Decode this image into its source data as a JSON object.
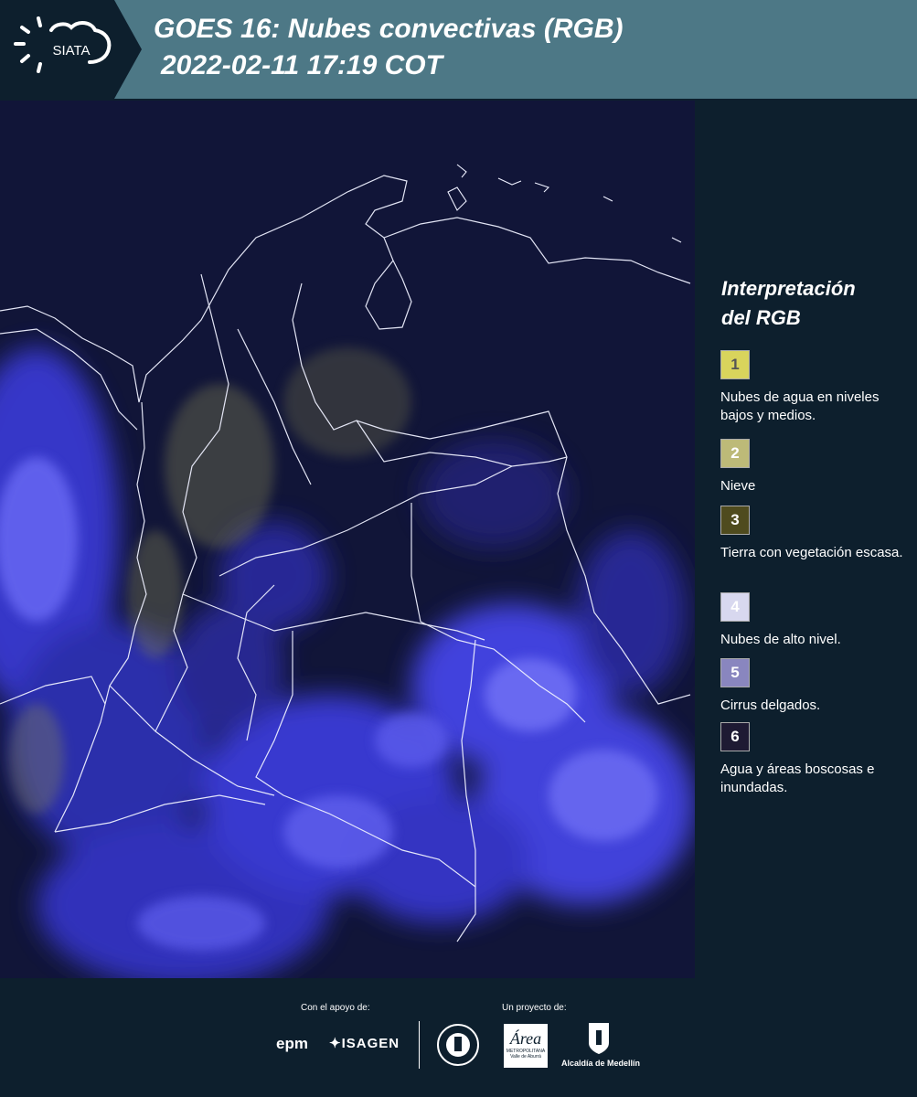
{
  "header": {
    "logo_text": "SIATA",
    "title_line1": "GOES 16: Nubes convectivas (RGB)",
    "title_line2": "2022-02-11 17:19 COT",
    "bg_color": "#4d7886"
  },
  "legend": {
    "title_line1": "Interpretación",
    "title_line2": "del RGB",
    "items": [
      {
        "num": "1",
        "label": "Nubes de agua en niveles bajos y medios.",
        "color": "#d9d45c",
        "num_color": "#555555"
      },
      {
        "num": "2",
        "label": "Nieve",
        "color": "#bdba78",
        "num_color": "#ffffff"
      },
      {
        "num": "3",
        "label": "Tierra con vegetación escasa.",
        "color": "#4f4b1e",
        "num_color": "#ffffff"
      },
      {
        "num": "4",
        "label": "Nubes de alto nivel.",
        "color": "#d8d8ef",
        "num_color": "#ffffff"
      },
      {
        "num": "5",
        "label": "Cirrus delgados.",
        "color": "#8986bf",
        "num_color": "#ffffff"
      },
      {
        "num": "6",
        "label": "Agua y áreas boscosas e inundadas.",
        "color": "#1e1a33",
        "num_color": "#ffffff"
      }
    ]
  },
  "footer": {
    "support_label": "Con el apoyo de:",
    "project_label": "Un proyecto de:",
    "sponsor1": "epm",
    "sponsor2": "ISAGEN",
    "area_text": "Área",
    "area_sub": "METROPOLITANA",
    "area_sub2": "Valle de Aburrá",
    "alcaldia": "Alcaldía de Medellín",
    "medellin_seal": "MEDELLÍN"
  }
}
